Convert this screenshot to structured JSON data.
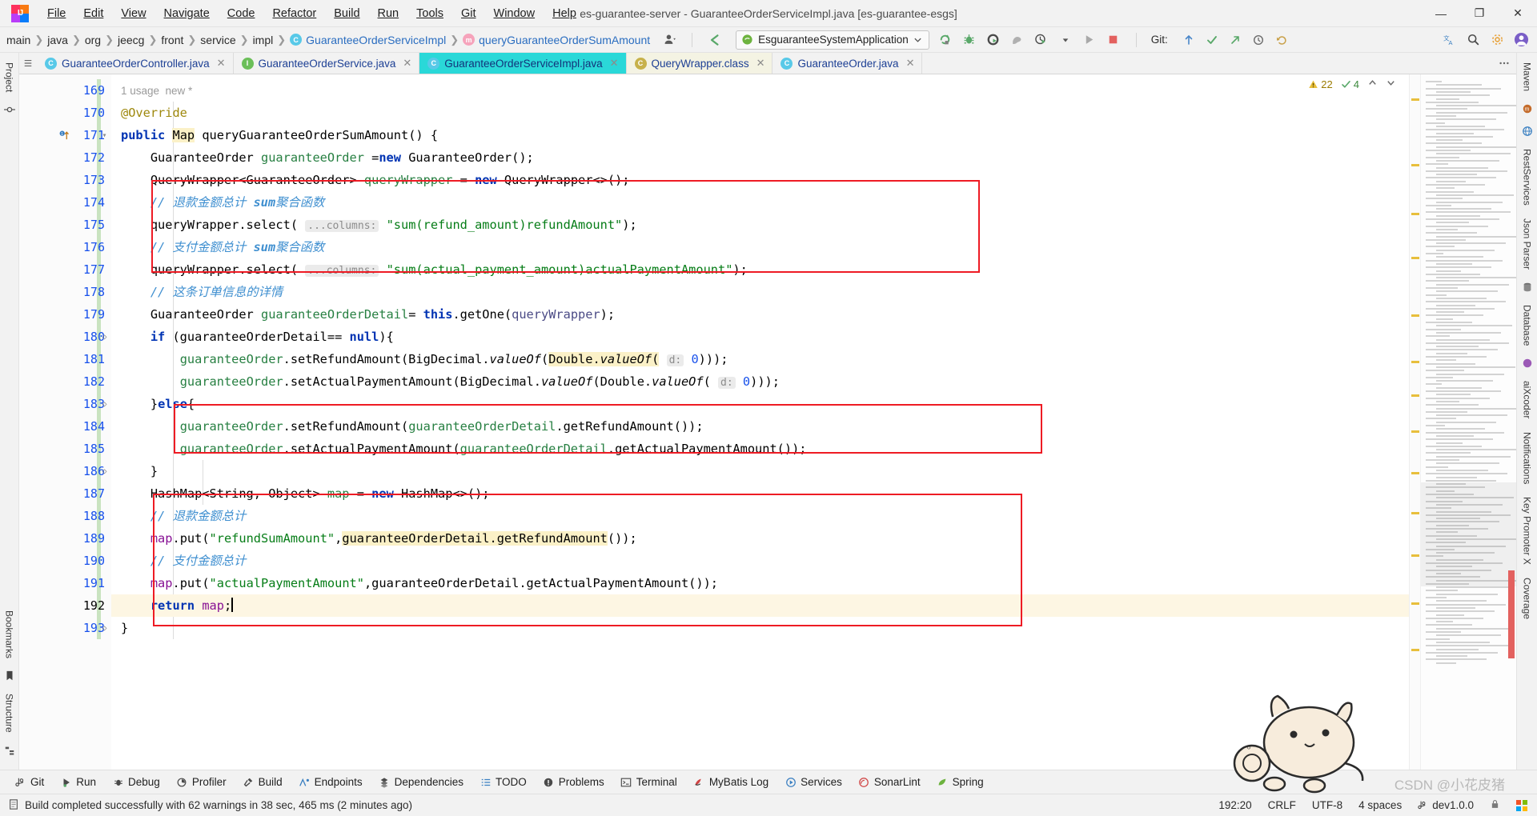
{
  "window": {
    "title": "es-guarantee-server - GuaranteeOrderServiceImpl.java [es-guarantee-esgs]",
    "minimize": "—",
    "maximize": "❐",
    "close": "✕",
    "logo_text": "IJ"
  },
  "menubar": [
    {
      "label": "File"
    },
    {
      "label": "Edit"
    },
    {
      "label": "View"
    },
    {
      "label": "Navigate"
    },
    {
      "label": "Code"
    },
    {
      "label": "Refactor"
    },
    {
      "label": "Build"
    },
    {
      "label": "Run"
    },
    {
      "label": "Tools"
    },
    {
      "label": "Git"
    },
    {
      "label": "Window"
    },
    {
      "label": "Help"
    }
  ],
  "breadcrumb": [
    {
      "label": "main",
      "icon": null
    },
    {
      "label": "java",
      "icon": null
    },
    {
      "label": "org",
      "icon": null
    },
    {
      "label": "jeecg",
      "icon": null
    },
    {
      "label": "front",
      "icon": null
    },
    {
      "label": "service",
      "icon": null
    },
    {
      "label": "impl",
      "icon": null
    },
    {
      "label": "GuaranteeOrderServiceImpl",
      "icon": "class-icon",
      "icon_letter": "C",
      "link": true
    },
    {
      "label": "queryGuaranteeOrderSumAmount",
      "icon": "method-icon",
      "icon_letter": "m",
      "link": true
    }
  ],
  "run_config": {
    "name": "EsguaranteeSystemApplication",
    "dropdown_icon": "chevron-down-icon",
    "app_icon": "spring-boot-icon"
  },
  "toolbar_icons": [
    {
      "name": "rerun-icon"
    },
    {
      "name": "debug-icon"
    },
    {
      "name": "run-with-coverage-icon"
    },
    {
      "name": "profiler-icon"
    },
    {
      "name": "run-history-icon"
    },
    {
      "name": "run-icon"
    },
    {
      "name": "stop-icon"
    }
  ],
  "git_toolbar": {
    "label": "Git:",
    "icons": [
      {
        "name": "git-update-icon"
      },
      {
        "name": "git-commit-icon"
      },
      {
        "name": "git-push-icon"
      },
      {
        "name": "git-history-icon"
      },
      {
        "name": "git-rollback-icon"
      }
    ]
  },
  "right_toolbar_icons": [
    {
      "name": "translate-icon"
    },
    {
      "name": "search-everywhere-icon"
    },
    {
      "name": "settings-icon"
    },
    {
      "name": "account-icon"
    }
  ],
  "editor_tabs": [
    {
      "label": "GuaranteeOrderController.java",
      "icon_letter": "C",
      "icon": "class-icon",
      "active": false,
      "closable": true
    },
    {
      "label": "GuaranteeOrderService.java",
      "icon_letter": "I",
      "icon": "interface-icon",
      "active": false,
      "closable": true
    },
    {
      "label": "GuaranteeOrderServiceImpl.java",
      "icon_letter": "C",
      "icon": "class-icon",
      "active": true,
      "closable": true
    },
    {
      "label": "QueryWrapper.class",
      "icon_letter": "C",
      "icon": "class-file-icon",
      "active": false,
      "closable": true
    },
    {
      "label": "GuaranteeOrder.java",
      "icon_letter": "C",
      "icon": "class-icon",
      "active": false,
      "closable": true
    }
  ],
  "left_rail": [
    {
      "label": "Project",
      "name": "sidebar-item-project"
    },
    {
      "label": "Bookmarks",
      "name": "sidebar-item-bookmarks"
    },
    {
      "label": "Structure",
      "name": "sidebar-item-structure"
    }
  ],
  "right_rail": [
    {
      "label": "Maven",
      "name": "sidebar-item-maven"
    },
    {
      "label": "RestServices",
      "name": "sidebar-item-restservices"
    },
    {
      "label": "Json Parser",
      "name": "sidebar-item-json-parser"
    },
    {
      "label": "Database",
      "name": "sidebar-item-database"
    },
    {
      "label": "aiXcoder",
      "name": "sidebar-item-aixcoder"
    },
    {
      "label": "Notifications",
      "name": "sidebar-item-notifications"
    },
    {
      "label": "Key Promoter X",
      "name": "sidebar-item-key-promoter-x"
    },
    {
      "label": "Coverage",
      "name": "sidebar-item-coverage"
    }
  ],
  "editor_inspection": {
    "warnings": "22",
    "checks": "4",
    "warn_icon": "warning-triangle-icon",
    "ok_icon": "checkmark-icon",
    "up_icon": "chevron-up-icon",
    "down_icon": "chevron-down-icon"
  },
  "gutter": {
    "first_line": 169,
    "lines": [
      169,
      170,
      171,
      172,
      173,
      174,
      175,
      176,
      177,
      178,
      179,
      180,
      181,
      182,
      183,
      184,
      185,
      186,
      187,
      188,
      189,
      190,
      191,
      192,
      193
    ],
    "current_line": 192,
    "override_marker_line": 171
  },
  "code_lines": [
    {
      "n": 169,
      "html": "<span class='inlay'>1 usage&nbsp;&nbsp;new *</span>",
      "raw": "1 usage  new *"
    },
    {
      "n": 170,
      "html": "<span class='ann'>@Override</span>",
      "raw": "@Override"
    },
    {
      "n": 171,
      "html": "<span class='kw'>public</span> <span class='hlbg'>Map</span> queryGuaranteeOrderSumAmount() {",
      "raw": "public Map queryGuaranteeOrderSumAmount() {"
    },
    {
      "n": 172,
      "html": "    GuaranteeOrder <span class='localvar'>guaranteeOrder</span> =<span class='kw'>new</span> GuaranteeOrder();",
      "raw": "    GuaranteeOrder guaranteeOrder =new GuaranteeOrder();"
    },
    {
      "n": 173,
      "html": "    QueryWrapper&lt;GuaranteeOrder&gt; <span class='localvar'>queryWrapper</span> = <span class='kw'>new</span> QueryWrapper&lt;&gt;();",
      "raw": "    QueryWrapper<GuaranteeOrder> queryWrapper = new QueryWrapper<>();"
    },
    {
      "n": 174,
      "html": "    <span class='cm'>// 退款金额总计 <b>sum</b>聚合函数</span>",
      "raw": "    // 退款金额总计 sum聚合函数"
    },
    {
      "n": 175,
      "html": "    queryWrapper.select( <span class='hint'>...columns:</span> <span class='str'>\"sum(refund_amount)refundAmount\"</span>);",
      "raw": "    queryWrapper.select( ...columns: \"sum(refund_amount)refundAmount\");"
    },
    {
      "n": 176,
      "html": "    <span class='cm'>// 支付金额总计 <b>sum</b>聚合函数</span>",
      "raw": "    // 支付金额总计 sum聚合函数"
    },
    {
      "n": 177,
      "html": "    queryWrapper.select( <span class='hint'>...columns:</span> <span class='str'>\"sum(actual_payment_amount)actualPaymentAmount\"</span>);",
      "raw": "    queryWrapper.select( ...columns: \"sum(actual_payment_amount)actualPaymentAmount\");"
    },
    {
      "n": 178,
      "html": "    <span class='cm'>// 这条订单信息的详情</span>",
      "raw": "    // 这条订单信息的详情"
    },
    {
      "n": 179,
      "html": "    GuaranteeOrder <span class='localvar'>guaranteeOrderDetail</span>= <span class='kw'>this</span>.getOne(<span class='param'>queryWrapper</span>);",
      "raw": "    GuaranteeOrder guaranteeOrderDetail= this.getOne(queryWrapper);"
    },
    {
      "n": 180,
      "html": "    <span class='kw'>if</span> (guaranteeOrderDetail== <span class='kw'>null</span>){",
      "raw": "    if (guaranteeOrderDetail== null){"
    },
    {
      "n": 181,
      "html": "        <span class='localvar'>guaranteeOrder</span>.setRefundAmount(BigDecimal.<span class='ital'>valueOf</span>(<span class='hlbg'>Double.<span class='ital'>valueOf</span>(</span> <span class='hint'>d:</span> <span class='num'>0</span>)));",
      "raw": "        guaranteeOrder.setRefundAmount(BigDecimal.valueOf(Double.valueOf( d: 0)));"
    },
    {
      "n": 182,
      "html": "        <span class='localvar'>guaranteeOrder</span>.setActualPaymentAmount(BigDecimal.<span class='ital'>valueOf</span>(Double.<span class='ital'>valueOf</span>( <span class='hint'>d:</span> <span class='num'>0</span>)));",
      "raw": "        guaranteeOrder.setActualPaymentAmount(BigDecimal.valueOf(Double.valueOf( d: 0)));"
    },
    {
      "n": 183,
      "html": "    }<span class='kw'>else</span>{",
      "raw": "    }else{"
    },
    {
      "n": 184,
      "html": "        <span class='localvar'>guaranteeOrder</span>.setRefundAmount(<span class='localvar'>guaranteeOrderDetail</span>.getRefundAmount());",
      "raw": "        guaranteeOrder.setRefundAmount(guaranteeOrderDetail.getRefundAmount());"
    },
    {
      "n": 185,
      "html": "        <span class='localvar'>guaranteeOrder</span>.setActualPaymentAmount(<span class='localvar'>guaranteeOrderDetail</span>.getActualPaymentAmount());",
      "raw": "        guaranteeOrder.setActualPaymentAmount(guaranteeOrderDetail.getActualPaymentAmount());"
    },
    {
      "n": 186,
      "html": "    }",
      "raw": "    }"
    },
    {
      "n": 187,
      "html": "    HashMap&lt;String, Object&gt; <span class='localvar'>map</span> = <span class='kw'>new</span> HashMap&lt;&gt;();",
      "raw": "    HashMap<String, Object> map = new HashMap<>();"
    },
    {
      "n": 188,
      "html": "    <span class='cm'>// 退款金额总计</span>",
      "raw": "    // 退款金额总计"
    },
    {
      "n": 189,
      "html": "    <span class='fld'>map</span>.put(<span class='str'>\"refundSumAmount\"</span>,<span class='hlbg'>guaranteeOrderDetail.getRefundAmount</span>());",
      "raw": "    map.put(\"refundSumAmount\",guaranteeOrderDetail.getRefundAmount());"
    },
    {
      "n": 190,
      "html": "    <span class='cm'>// 支付金额总计</span>",
      "raw": "    // 支付金额总计"
    },
    {
      "n": 191,
      "html": "    <span class='fld'>map</span>.put(<span class='str'>\"actualPaymentAmount\"</span>,guaranteeOrderDetail.getActualPaymentAmount());",
      "raw": "    map.put(\"actualPaymentAmount\",guaranteeOrderDetail.getActualPaymentAmount());"
    },
    {
      "n": 192,
      "html": "    <span class='kw'>return</span> <span class='fld'>map</span>;<span class='caret'></span>",
      "raw": "    return map;"
    },
    {
      "n": 193,
      "html": "}",
      "raw": "}"
    }
  ],
  "annotations": {
    "color": "#ee1b24",
    "boxes": [
      {
        "name": "highlight-box-select-statements",
        "line_start": 174,
        "line_end": 177
      },
      {
        "name": "highlight-box-else-branch",
        "line_start": 184,
        "line_end": 185
      },
      {
        "name": "highlight-box-map-put",
        "line_start": 188,
        "line_end": 192
      }
    ]
  },
  "bottom_toolwindows": [
    {
      "label": "Git",
      "icon": "git-branch-icon",
      "name": "toolwindow-git"
    },
    {
      "label": "Run",
      "icon": "run-icon",
      "name": "toolwindow-run"
    },
    {
      "label": "Debug",
      "icon": "debug-icon",
      "name": "toolwindow-debug"
    },
    {
      "label": "Profiler",
      "icon": "profiler-icon",
      "name": "toolwindow-profiler"
    },
    {
      "label": "Build",
      "icon": "build-hammer-icon",
      "name": "toolwindow-build"
    },
    {
      "label": "Endpoints",
      "icon": "endpoints-icon",
      "name": "toolwindow-endpoints"
    },
    {
      "label": "Dependencies",
      "icon": "dependencies-icon",
      "name": "toolwindow-dependencies"
    },
    {
      "label": "TODO",
      "icon": "todo-list-icon",
      "name": "toolwindow-todo"
    },
    {
      "label": "Problems",
      "icon": "problems-icon",
      "name": "toolwindow-problems"
    },
    {
      "label": "Terminal",
      "icon": "terminal-icon",
      "name": "toolwindow-terminal"
    },
    {
      "label": "MyBatis Log",
      "icon": "mybatis-icon",
      "name": "toolwindow-mybatis-log"
    },
    {
      "label": "Services",
      "icon": "services-icon",
      "name": "toolwindow-services"
    },
    {
      "label": "SonarLint",
      "icon": "sonarlint-icon",
      "name": "toolwindow-sonarlint"
    },
    {
      "label": "Spring",
      "icon": "spring-leaf-icon",
      "name": "toolwindow-spring"
    }
  ],
  "statusbar": {
    "message": "Build completed successfully with 62 warnings in 38 sec, 465 ms (2 minutes ago)",
    "message_icon": "build-status-icon",
    "caret_position": "192:20",
    "line_separator": "CRLF",
    "encoding": "UTF-8",
    "indent": "4 spaces",
    "branch": "dev1.0.0",
    "branch_icon": "git-branch-icon",
    "lock_icon": "lock-icon"
  },
  "watermark": {
    "text": "CSDN @小花皮猪"
  },
  "colors": {
    "accent_tab_active": "#2ad8d8",
    "annotation_red": "#ee1b24",
    "keyword_blue": "#0033b3",
    "string_green": "#067d17",
    "comment_blue": "#3f8fd0",
    "highlight_yellow": "#fbf1c7",
    "background": "#ffffff",
    "chrome": "#f2f2f2"
  }
}
